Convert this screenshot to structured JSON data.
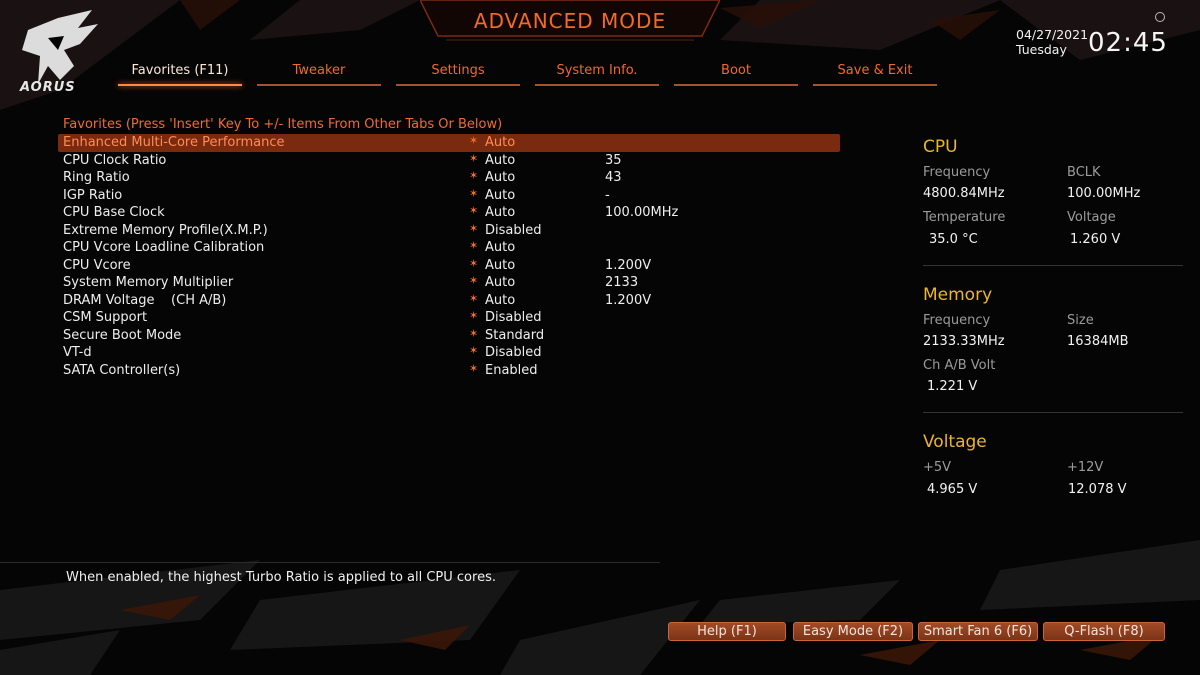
{
  "header": {
    "brand": "AORUS",
    "title": "ADVANCED MODE",
    "date": "04/27/2021",
    "day": "Tuesday",
    "time": "02:45",
    "settings_icon": "gear-icon"
  },
  "tabs": [
    {
      "label": "Favorites (F11)",
      "active": true
    },
    {
      "label": "Tweaker"
    },
    {
      "label": "Settings"
    },
    {
      "label": "System Info."
    },
    {
      "label": "Boot"
    },
    {
      "label": "Save & Exit"
    }
  ],
  "favorites": {
    "heading": "Favorites (Press 'Insert' Key To +/- Items From Other Tabs Or Below)",
    "items": [
      {
        "name": "Enhanced Multi-Core Performance",
        "value": "Auto",
        "current": "",
        "selected": true
      },
      {
        "name": "CPU Clock Ratio",
        "value": "Auto",
        "current": "35"
      },
      {
        "name": "Ring Ratio",
        "value": "Auto",
        "current": "43"
      },
      {
        "name": "IGP Ratio",
        "value": "Auto",
        "current": "-"
      },
      {
        "name": "CPU Base Clock",
        "value": "Auto",
        "current": "100.00MHz"
      },
      {
        "name": "Extreme Memory Profile(X.M.P.)",
        "value": "Disabled",
        "current": ""
      },
      {
        "name": "CPU Vcore Loadline Calibration",
        "value": "Auto",
        "current": ""
      },
      {
        "name": "CPU Vcore",
        "value": "Auto",
        "current": "1.200V"
      },
      {
        "name": "System Memory Multiplier",
        "value": "Auto",
        "current": "2133"
      },
      {
        "name": "DRAM Voltage    (CH A/B)",
        "value": "Auto",
        "current": "1.200V"
      },
      {
        "name": "CSM Support",
        "value": "Disabled",
        "current": ""
      },
      {
        "name": "Secure Boot Mode",
        "value": "Standard",
        "current": ""
      },
      {
        "name": "VT-d",
        "value": "Disabled",
        "current": ""
      },
      {
        "name": "SATA Controller(s)",
        "value": "Enabled",
        "current": ""
      }
    ],
    "favorite_icon": "star-icon"
  },
  "help_text": "When enabled, the highest Turbo Ratio is applied to all CPU cores.",
  "monitor": {
    "cpu": {
      "title": "CPU",
      "frequency_label": "Frequency",
      "frequency": "4800.84MHz",
      "bclk_label": "BCLK",
      "bclk": "100.00MHz",
      "temperature_label": "Temperature",
      "temperature": "35.0 °C",
      "voltage_label": "Voltage",
      "voltage": "1.260 V"
    },
    "memory": {
      "title": "Memory",
      "frequency_label": "Frequency",
      "frequency": "2133.33MHz",
      "size_label": "Size",
      "size": "16384MB",
      "volt_label": "Ch A/B Volt",
      "volt": "1.221 V"
    },
    "voltage": {
      "title": "Voltage",
      "p5v_label": "+5V",
      "p5v": "4.965 V",
      "p12v_label": "+12V",
      "p12v": "12.078 V"
    }
  },
  "footer": {
    "help": "Help (F1)",
    "easy_mode": "Easy Mode (F2)",
    "smart_fan": "Smart Fan 6 (F6)",
    "qflash": "Q-Flash (F8)"
  },
  "colors": {
    "accent": "#f06a2a",
    "section_title": "#ebb431",
    "background": "#050505"
  }
}
